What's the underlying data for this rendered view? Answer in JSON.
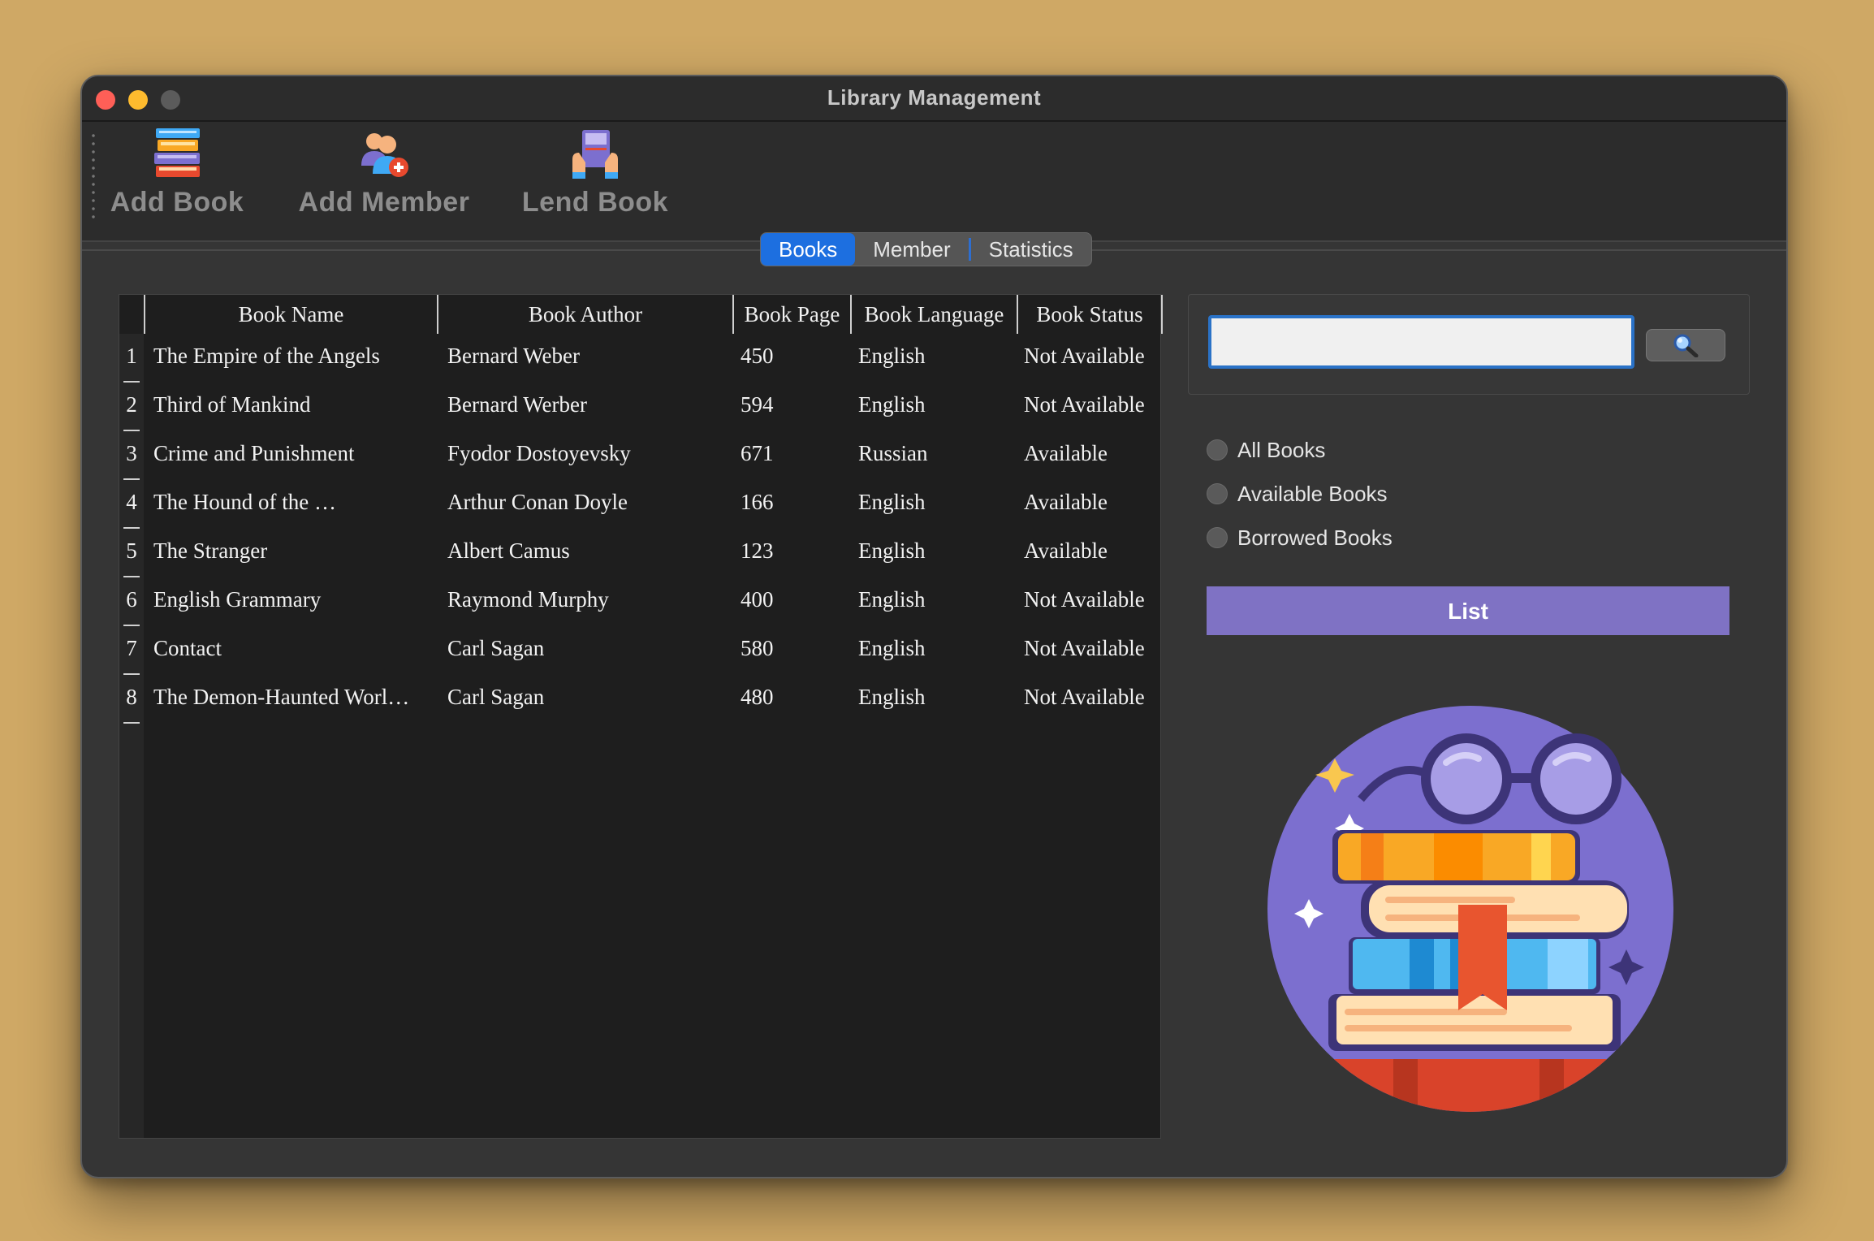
{
  "window": {
    "title": "Library Management"
  },
  "toolbar": {
    "add_book": {
      "label": "Add Book",
      "icon": "books-stack-icon"
    },
    "add_member": {
      "label": "Add Member",
      "icon": "add-user-icon"
    },
    "lend_book": {
      "label": "Lend Book",
      "icon": "lend-book-icon"
    }
  },
  "tabs": [
    {
      "label": "Books",
      "active": true
    },
    {
      "label": "Member",
      "active": false
    },
    {
      "label": "Statistics",
      "active": false
    }
  ],
  "table": {
    "columns": [
      "Book Name",
      "Book Author",
      "Book Page",
      "Book Language",
      "Book Status"
    ],
    "rows": [
      {
        "num": "1",
        "name": "The Empire of the Angels",
        "author": "Bernard Weber",
        "pages": "450",
        "language": "English",
        "status": "Not Available"
      },
      {
        "num": "2",
        "name": "Third of Mankind",
        "author": "Bernard Werber",
        "pages": "594",
        "language": "English",
        "status": "Not Available"
      },
      {
        "num": "3",
        "name": "Crime and Punishment",
        "author": "Fyodor Dostoyevsky",
        "pages": "671",
        "language": "Russian",
        "status": "Available"
      },
      {
        "num": "4",
        "name": "The Hound of the …",
        "author": "Arthur Conan Doyle",
        "pages": "166",
        "language": "English",
        "status": "Available"
      },
      {
        "num": "5",
        "name": "The Stranger",
        "author": "Albert Camus",
        "pages": "123",
        "language": "English",
        "status": "Available"
      },
      {
        "num": "6",
        "name": "English Grammary",
        "author": "Raymond Murphy",
        "pages": "400",
        "language": "English",
        "status": "Not Available"
      },
      {
        "num": "7",
        "name": "Contact",
        "author": "Carl Sagan",
        "pages": "580",
        "language": "English",
        "status": "Not Available"
      },
      {
        "num": "8",
        "name": "The Demon-Haunted Worl…",
        "author": "Carl Sagan",
        "pages": "480",
        "language": "English",
        "status": "Not Available"
      }
    ]
  },
  "search": {
    "value": "",
    "placeholder": "",
    "button_icon": "search-icon"
  },
  "filters": [
    {
      "label": "All Books",
      "checked": false
    },
    {
      "label": "Available Books",
      "checked": false
    },
    {
      "label": "Borrowed Books",
      "checked": false
    }
  ],
  "list_button": {
    "label": "List"
  },
  "colors": {
    "background": "#cfa865",
    "window": "#353535",
    "accent_tab": "#1d6fe0",
    "list_button": "#7f72c4",
    "search_border": "#2a72c7"
  }
}
